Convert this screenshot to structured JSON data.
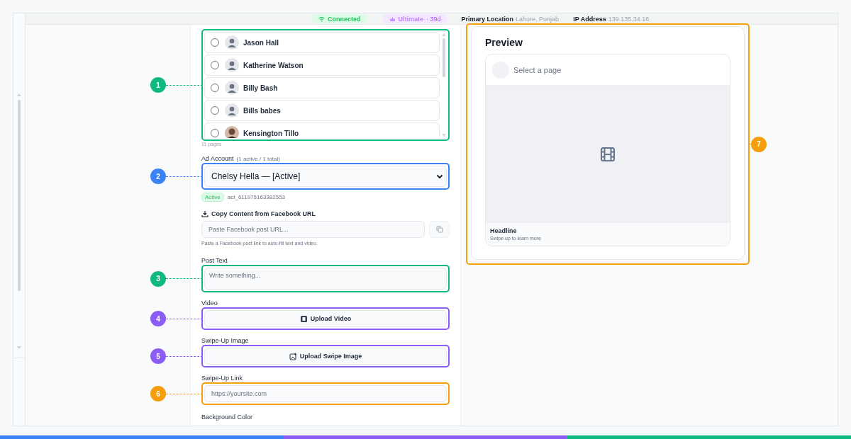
{
  "header": {
    "status": {
      "label": "Connected"
    },
    "plan": {
      "label": "Ultimate",
      "suffix": "· 39d"
    },
    "info": [
      {
        "label": "Primary Location",
        "value": "Lahore, Punjab"
      },
      {
        "label": "IP Address",
        "value": "139.135.34.16"
      }
    ]
  },
  "form": {
    "pages": {
      "callout": {
        "number": "1",
        "color": "#10b981"
      },
      "items": [
        {
          "name": "Jason Hall",
          "selected": false,
          "photo": false
        },
        {
          "name": "Katherine Watson",
          "selected": false,
          "photo": false
        },
        {
          "name": "Billy Bash",
          "selected": false,
          "photo": false
        },
        {
          "name": "Bills babes",
          "selected": false,
          "photo": false
        },
        {
          "name": "Kensington Tillo",
          "selected": false,
          "photo": true
        }
      ],
      "count": "11 pages"
    },
    "ad_account": {
      "label": "Ad Account",
      "note": "(1 active / 1 total)",
      "value": "Chelsy Hella — [Active]",
      "status_badge": "Active",
      "account_id": "act_611975163382553",
      "callout": {
        "number": "2",
        "color": "#3b82f6"
      }
    },
    "copy_from_url": {
      "label": "Copy Content from Facebook URL",
      "placeholder": "Paste Facebook post URL...",
      "hint": "Paste a Facebook post link to auto-fill text and video."
    },
    "post_text": {
      "label": "Post Text",
      "placeholder": "Write something...",
      "callout": {
        "number": "3",
        "color": "#10b981"
      }
    },
    "video": {
      "label": "Video",
      "button": "Upload Video",
      "callout": {
        "number": "4",
        "color": "#8b5cf6"
      }
    },
    "swipe_image": {
      "label": "Swipe-Up Image",
      "button": "Upload Swipe Image",
      "callout": {
        "number": "5",
        "color": "#8b5cf6"
      }
    },
    "swipe_link": {
      "label": "Swipe-Up Link",
      "placeholder": "https://yoursite.com",
      "callout": {
        "number": "6",
        "color": "#f59e0b"
      }
    },
    "background_color": {
      "label": "Background Color"
    }
  },
  "preview": {
    "title": "Preview",
    "page_placeholder": "Select a page",
    "headline": "Headline",
    "caption": "Swipe up to learn more",
    "callout": {
      "number": "7",
      "color": "#f59e0b"
    }
  }
}
